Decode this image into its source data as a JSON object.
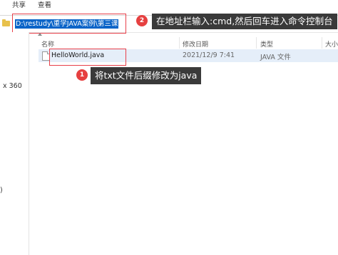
{
  "ribbon": {
    "tabs": [
      "共享",
      "查看"
    ]
  },
  "address_bar": {
    "path": "D:\\restudy\\重学JAVA案例\\第三课"
  },
  "annotations": [
    {
      "badge": "2",
      "text": "在地址栏输入:cmd,然后回车进入命令控制台"
    },
    {
      "badge": "1",
      "text": "将txt文件后缀修改为java"
    }
  ],
  "nav_fragments": [
    "x 360",
    ")"
  ],
  "columns": [
    "名称",
    "修改日期",
    "类型",
    "大小"
  ],
  "files": [
    {
      "name": "HelloWorld.java",
      "modified": "2021/12/9 7:41",
      "type": "JAVA 文件",
      "size": ""
    }
  ],
  "colors": {
    "highlight": "#e64040",
    "selection": "#0a64c8",
    "row_hover": "#e5eef9"
  }
}
